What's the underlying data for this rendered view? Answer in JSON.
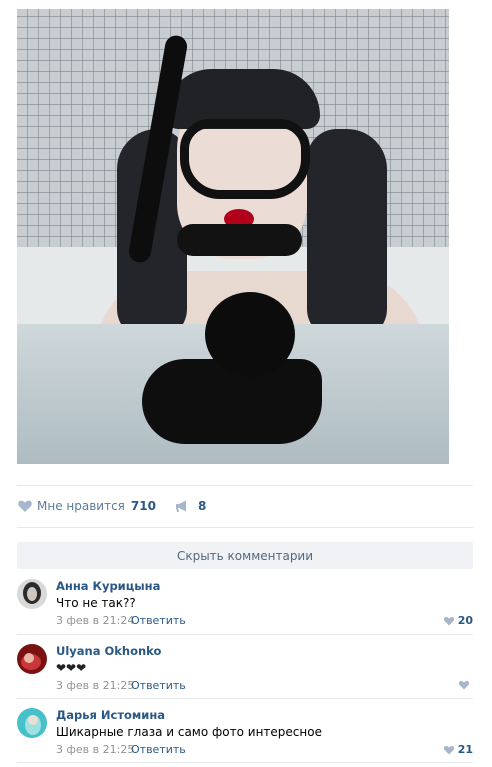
{
  "post": {
    "image_alt": "photo"
  },
  "actions": {
    "like_label": "Мне нравится",
    "like_count": "710",
    "share_count": "8"
  },
  "comments_toggle": "Скрыть комментарии",
  "comments": [
    {
      "author": "Анна Курицына",
      "text": "Что не так??",
      "date": "3 фев в 21:24",
      "reply": "Ответить",
      "likes": "20"
    },
    {
      "author": "Ulyana Okhonko",
      "text": "❤❤❤",
      "date": "3 фев в 21:25",
      "reply": "Ответить",
      "likes": ""
    },
    {
      "author": "Дарья Истомина",
      "text": "Шикарные глаза и само фото интересное",
      "date": "3 фев в 21:25",
      "reply": "Ответить",
      "likes": "21"
    }
  ],
  "colors": {
    "link": "#2a5885",
    "muted": "#939393",
    "heart": "#a7b7cb"
  }
}
